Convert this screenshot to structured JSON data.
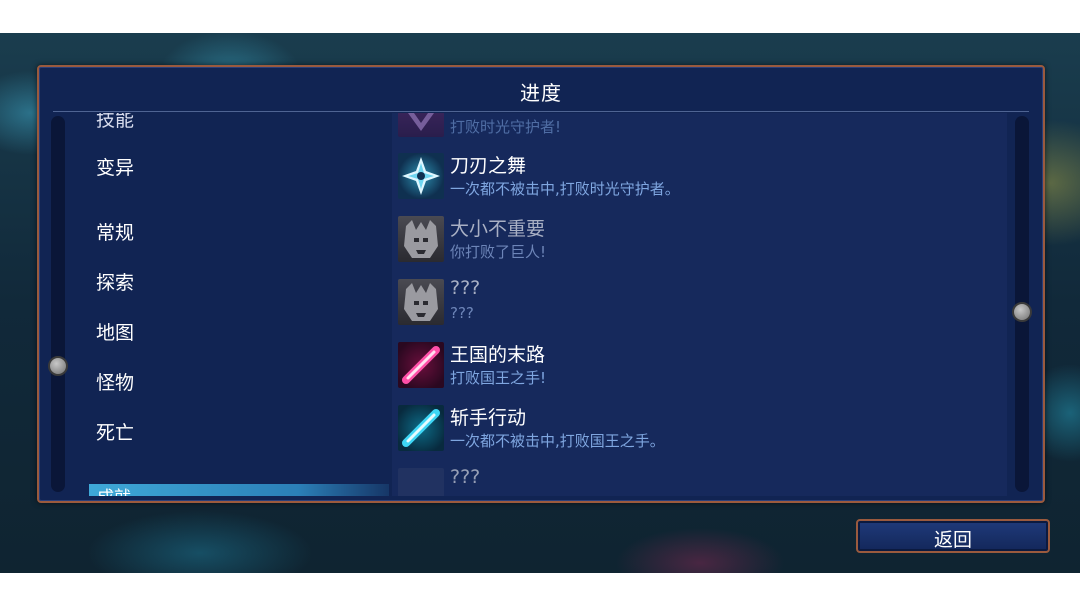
{
  "panel": {
    "title": "进度"
  },
  "categories": {
    "partial_top": "技能",
    "items": [
      "变异",
      "常规",
      "探索",
      "地图",
      "怪物",
      "死亡"
    ],
    "selected_partial": "成就"
  },
  "achievements": [
    {
      "name": "",
      "desc": "打败时光守护者!",
      "icon": "purple-emblem-icon",
      "state": "faded"
    },
    {
      "name": "刀刃之舞",
      "desc": "一次都不被击中,打败时光守护者。",
      "icon": "shuriken-icon",
      "state": "unlocked"
    },
    {
      "name": "大小不重要",
      "desc": "你打败了巨人!",
      "icon": "giant-head-icon",
      "state": "locked"
    },
    {
      "name": "???",
      "desc": "???",
      "icon": "giant-head-icon",
      "state": "locked"
    },
    {
      "name": "王国的末路",
      "desc": "打败国王之手!",
      "icon": "pink-blade-icon",
      "state": "unlocked"
    },
    {
      "name": "斩手行动",
      "desc": "一次都不被击中,打败国王之手。",
      "icon": "cyan-blade-icon",
      "state": "unlocked"
    },
    {
      "name": "???",
      "desc": "",
      "icon": "locked-icon",
      "state": "faded"
    }
  ],
  "back_button": {
    "label": "返回"
  },
  "colors": {
    "panel": "#112453",
    "border": "#9a5a3e",
    "desc_text": "#7fa6e0",
    "selected_tab": "#3fa9d8"
  }
}
